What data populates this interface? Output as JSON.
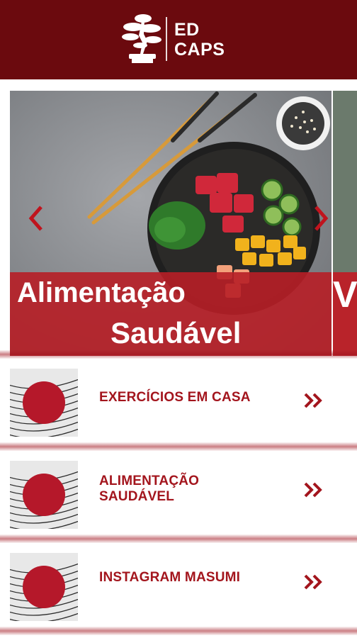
{
  "header": {
    "logo_line1": "ED",
    "logo_line2": "CAPS"
  },
  "carousel": {
    "slide_title_line1": "Alimentação",
    "slide_title_line2": "Saudável",
    "next_slide_peek": "V",
    "prev_icon": "chevron-left-icon",
    "next_icon": "chevron-right-icon"
  },
  "menu": {
    "items": [
      {
        "label_line1": "EXERCÍCIOS EM CASA",
        "label_line2": ""
      },
      {
        "label_line1": "ALIMENTAÇÃO",
        "label_line2": "SAUDÁVEL"
      },
      {
        "label_line1": "INSTAGRAM MASUMI",
        "label_line2": ""
      }
    ],
    "item_icon": "double-chevron-right-icon"
  },
  "colors": {
    "header_bg": "#6b0a0e",
    "accent": "#a3151d",
    "banner": "#b71e26",
    "rising_sun": "#b5182a"
  }
}
